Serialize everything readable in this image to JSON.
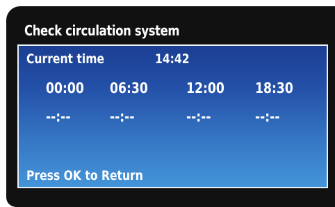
{
  "window": {
    "title": "Check circulation system"
  },
  "status": {
    "current_time_label": "Current time",
    "current_time_value": "14:42"
  },
  "schedule": {
    "times": [
      "00:00",
      "06:30",
      "12:00",
      "18:30"
    ],
    "values": [
      "--:--",
      "--:--",
      "--:--",
      "--:--"
    ]
  },
  "footer": {
    "hint": "Press OK to Return"
  },
  "colors": {
    "bezel": "#111111",
    "screen_top": "#1b3f93",
    "screen_bottom": "#4494d8",
    "text": "#ffffff"
  }
}
